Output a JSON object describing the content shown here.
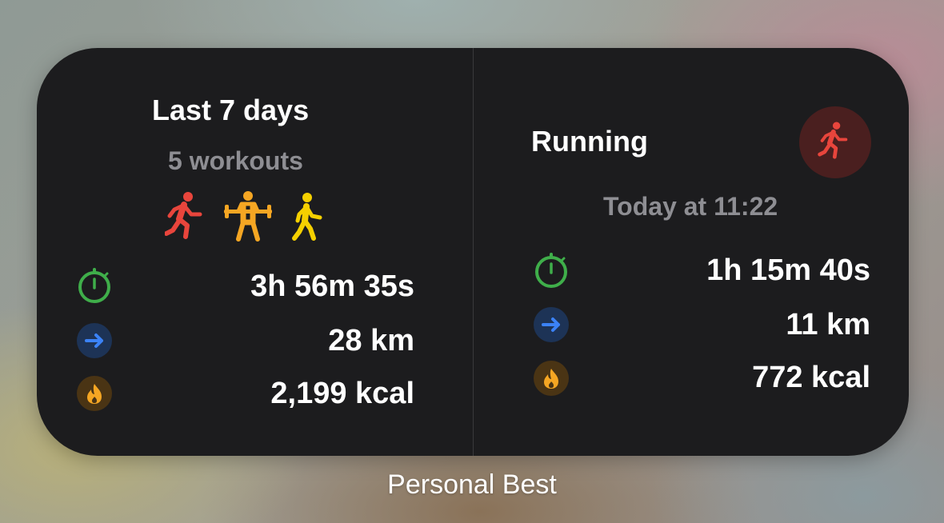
{
  "widget": {
    "left_panel": {
      "title": "Last 7 days",
      "subtitle": "5 workouts",
      "activity_icons": [
        "running-icon",
        "weightlifting-icon",
        "walking-icon"
      ],
      "stats": [
        {
          "icon": "stopwatch-icon",
          "value": "3h 56m 35s"
        },
        {
          "icon": "distance-arrow-icon",
          "value": "28 km"
        },
        {
          "icon": "flame-icon",
          "value": "2,199 kcal"
        }
      ]
    },
    "right_panel": {
      "title": "Running",
      "badge_icon": "running-icon",
      "timestamp": "Today at 11:22",
      "stats": [
        {
          "icon": "stopwatch-icon",
          "value": "1h 15m 40s"
        },
        {
          "icon": "distance-arrow-icon",
          "value": "11 km"
        },
        {
          "icon": "flame-icon",
          "value": "772 kcal"
        }
      ]
    }
  },
  "caption": "Personal Best",
  "colors": {
    "widget_bg": "#1c1c1e",
    "stopwatch": "#3fae4a",
    "distance": "#3b82f6",
    "flame": "#f5a623",
    "running": "#e8453c",
    "weightlifting": "#f5a623",
    "walking": "#f5d000",
    "secondary_text": "#8e8e93"
  }
}
